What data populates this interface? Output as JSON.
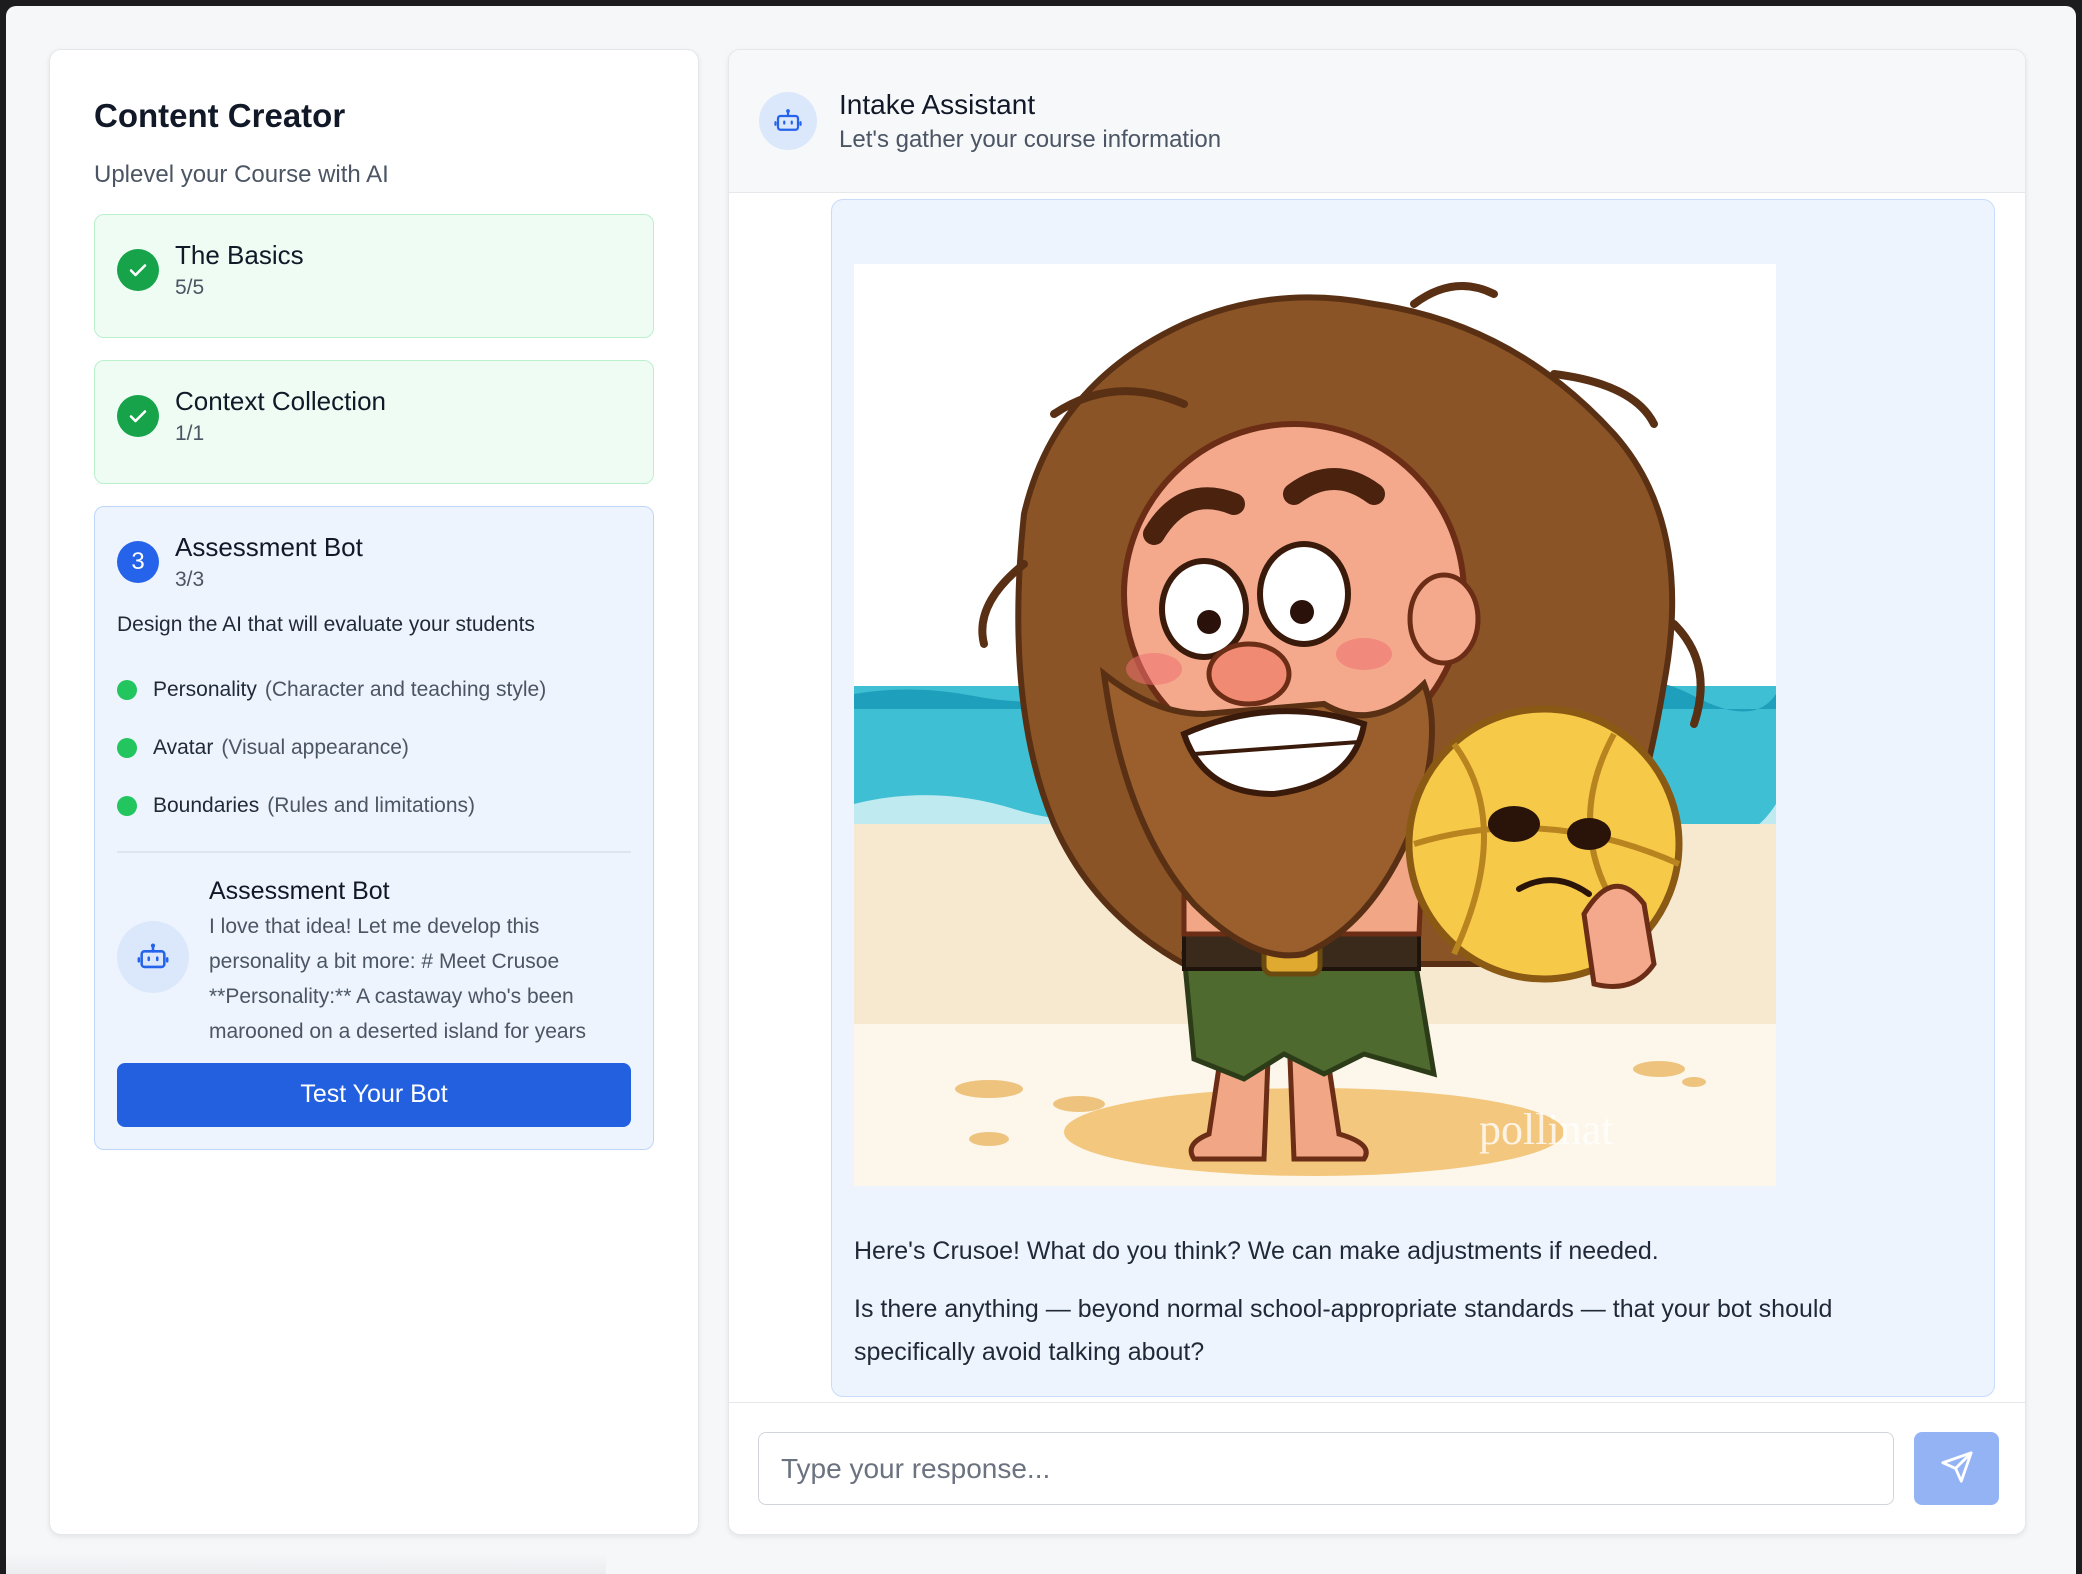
{
  "sidebar": {
    "title": "Content Creator",
    "subtitle": "Uplevel your Course with AI",
    "steps": [
      {
        "name": "The Basics",
        "count": "5/5",
        "status": "complete"
      },
      {
        "name": "Context Collection",
        "count": "1/1",
        "status": "complete"
      },
      {
        "number": "3",
        "name": "Assessment Bot",
        "count": "3/3",
        "status": "active",
        "description": "Design the AI that will evaluate your students",
        "items": [
          {
            "name": "Personality",
            "hint": "(Character and teaching style)"
          },
          {
            "name": "Avatar",
            "hint": "(Visual appearance)"
          },
          {
            "name": "Boundaries",
            "hint": "(Rules and limitations)"
          }
        ],
        "preview": {
          "name": "Assessment Bot",
          "message": "I love that idea! Let me develop this personality a bit more: # Meet Crusoe **Personality:** A castaway who's been marooned on a deserted island for years"
        },
        "button_label": "Test Your Bot"
      }
    ]
  },
  "chat": {
    "header": {
      "title": "Intake Assistant",
      "subtitle": "Let's gather your course information",
      "icon": "robot-icon"
    },
    "message": {
      "image_watermark": "pollinat",
      "paragraphs": [
        "Here's Crusoe! What do you think? We can make adjustments if needed.",
        "Is there anything — beyond normal school-appropriate standards — that your bot should specifically avoid talking about?"
      ]
    },
    "composer": {
      "placeholder": "Type your response...",
      "send_icon": "send-icon"
    }
  },
  "colors": {
    "accent": "#2360e0",
    "complete_green": "#16a34a",
    "dot_green": "#22c55e",
    "send_disabled": "#93b3f5"
  }
}
